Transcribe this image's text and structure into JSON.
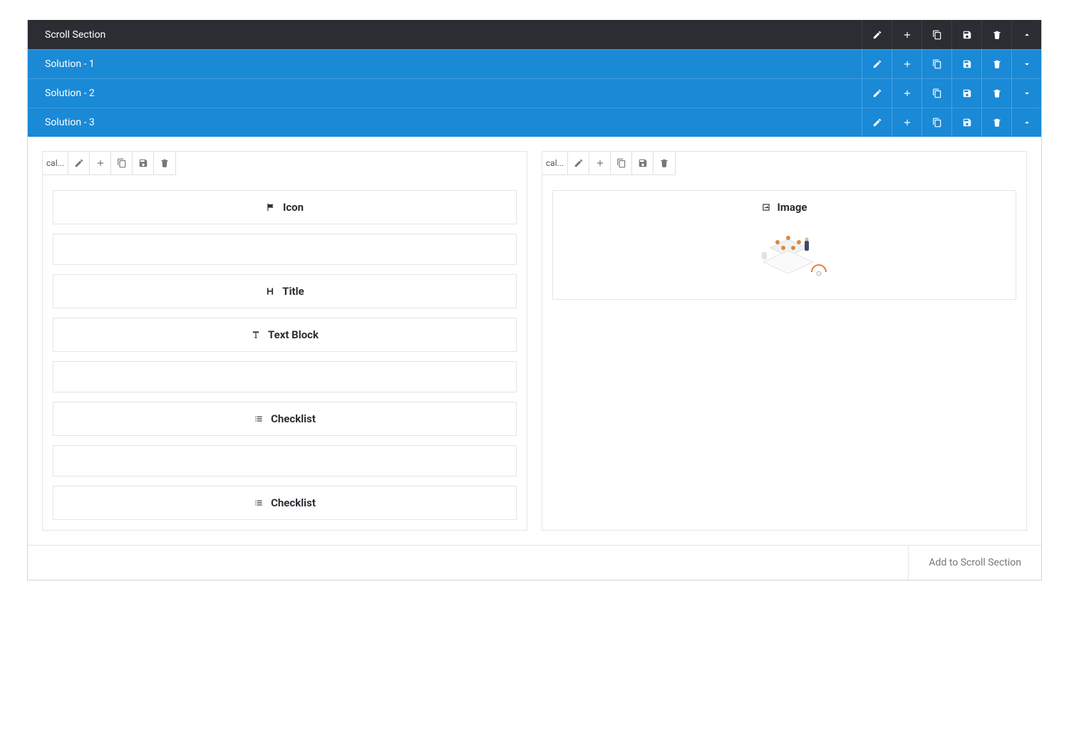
{
  "headers": {
    "scroll_section": {
      "title": "Scroll Section",
      "expand": "up"
    },
    "rows": [
      {
        "title": "Solution - 1",
        "expand": "down"
      },
      {
        "title": "Solution - 2",
        "expand": "down"
      },
      {
        "title": "Solution - 3",
        "expand": "up"
      }
    ]
  },
  "columns": {
    "left": {
      "toolbar_label": "cal...",
      "blocks": [
        {
          "type": "icon",
          "label": "Icon"
        },
        {
          "type": "empty"
        },
        {
          "type": "title",
          "label": "Title"
        },
        {
          "type": "textblock",
          "label": "Text Block"
        },
        {
          "type": "empty"
        },
        {
          "type": "checklist",
          "label": "Checklist"
        },
        {
          "type": "empty"
        },
        {
          "type": "checklist2",
          "label": "Checklist"
        }
      ]
    },
    "right": {
      "toolbar_label": "cal...",
      "blocks": [
        {
          "type": "image",
          "label": "Image"
        }
      ]
    }
  },
  "footer": {
    "add_label": "Add to Scroll Section"
  }
}
